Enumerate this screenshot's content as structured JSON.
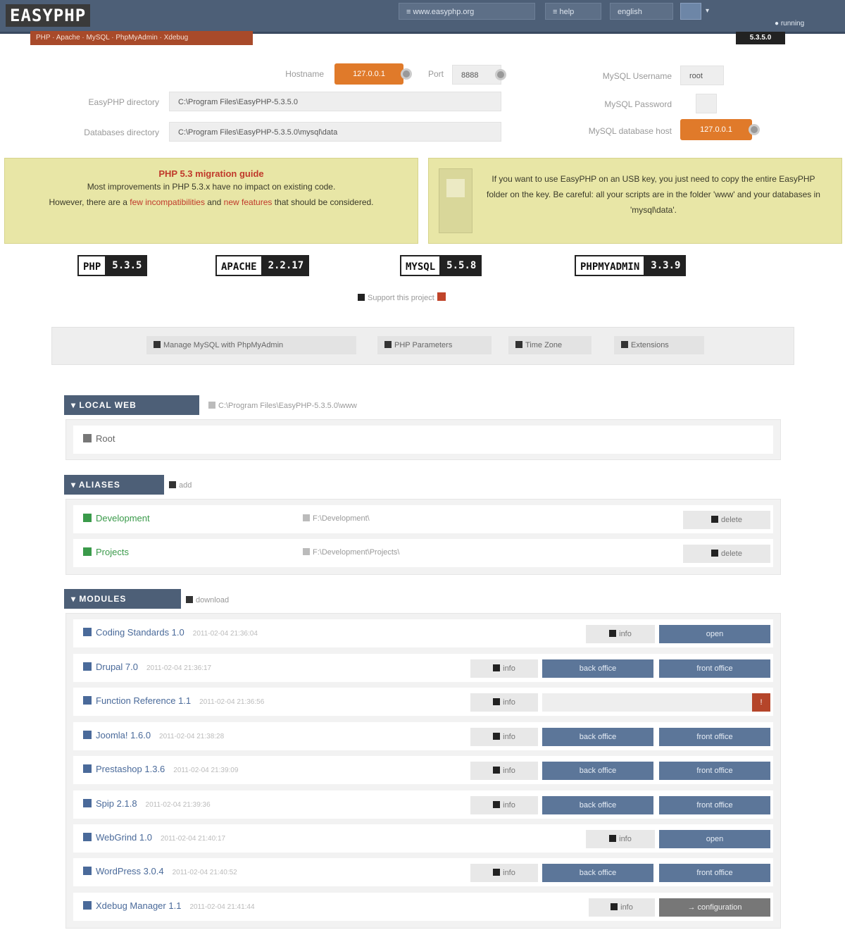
{
  "header": {
    "logo": "EASYPHP",
    "nav": [
      "≡ www.easyphp.org",
      "≡ help",
      "english"
    ],
    "flag_arrow": "▾",
    "subbanner": "PHP · Apache · MySQL · PhpMyAdmin · Xdebug",
    "status": "● running",
    "version": "5.3.5.0"
  },
  "settings": {
    "hostname_label": "Hostname",
    "hostname_value": "127.0.0.1",
    "port_label": "Port",
    "port_value": "8888",
    "easyphp_dir_label": "EasyPHP directory",
    "easyphp_dir_value": "C:\\Program Files\\EasyPHP-5.3.5.0",
    "db_dir_label": "Databases directory",
    "db_dir_value": "C:\\Program Files\\EasyPHP-5.3.5.0\\mysql\\data",
    "mysql_user_label": "MySQL Username",
    "mysql_user_value": "root",
    "mysql_pass_label": "MySQL Password",
    "mysql_pass_value": "",
    "mysql_host_label": "MySQL database host",
    "mysql_host_value": "127.0.0.1"
  },
  "notices": {
    "left_title": "PHP 5.3 migration guide",
    "left_text_1": "Most improvements in PHP 5.3.x have no impact on existing code.",
    "left_text_2": "However, there are a",
    "left_link_1": "few incompatibilities",
    "left_text_3": "and",
    "left_link_2": "new features",
    "left_text_4": "that should be considered.",
    "right_text": "If you want to use EasyPHP on an USB key, you just need to copy the entire EasyPHP folder on the key. Be careful: all your scripts are in the folder 'www' and your databases in 'mysql\\data'."
  },
  "versions": [
    {
      "name": "PHP",
      "version": "5.3.5"
    },
    {
      "name": "APACHE",
      "version": "2.2.17"
    },
    {
      "name": "MYSQL",
      "version": "5.5.8"
    },
    {
      "name": "PHPMYADMIN",
      "version": "3.3.9"
    }
  ],
  "support_label": "Support this project",
  "toolbar": {
    "phpmyadmin": "Manage MySQL with PhpMyAdmin",
    "phpinfo": "PHP Parameters",
    "timezone": "Time Zone",
    "extensions": "Extensions"
  },
  "localweb": {
    "title": "▾ LOCAL WEB",
    "path": "C:\\Program Files\\EasyPHP-5.3.5.0\\www",
    "item": "Root"
  },
  "aliases": {
    "title": "▾ ALIASES",
    "add_label": "add",
    "items": [
      {
        "name": "Development",
        "path": "F:\\Development\\",
        "action": "delete"
      },
      {
        "name": "Projects",
        "path": "F:\\Development\\Projects\\",
        "action": "delete"
      }
    ]
  },
  "modules": {
    "title": "▾ MODULES",
    "download_label": "download",
    "info_label": "info",
    "back_office": "back office",
    "front_office": "front office",
    "open": "open",
    "configuration": "→ configuration",
    "error_mark": "!",
    "items": [
      {
        "name": "Coding Standards 1.0",
        "date": "2011-02-04 21:36:04"
      },
      {
        "name": "Drupal 7.0",
        "date": "2011-02-04 21:36:17"
      },
      {
        "name": "Function Reference 1.1",
        "date": "2011-02-04 21:36:56"
      },
      {
        "name": "Joomla! 1.6.0",
        "date": "2011-02-04 21:38:28"
      },
      {
        "name": "Prestashop 1.3.6",
        "date": "2011-02-04 21:39:09"
      },
      {
        "name": "Spip 2.1.8",
        "date": "2011-02-04 21:39:36"
      },
      {
        "name": "WebGrind 1.0",
        "date": "2011-02-04 21:40:17"
      },
      {
        "name": "WordPress 3.0.4",
        "date": "2011-02-04 21:40:52"
      },
      {
        "name": "Xdebug Manager 1.1",
        "date": "2011-02-04 21:41:44"
      }
    ]
  },
  "colors": {
    "header": "#4d5f77",
    "accent_orange": "#e07a2a",
    "notice_yellow": "#e8e6a6",
    "button_blue": "#5c7699"
  }
}
